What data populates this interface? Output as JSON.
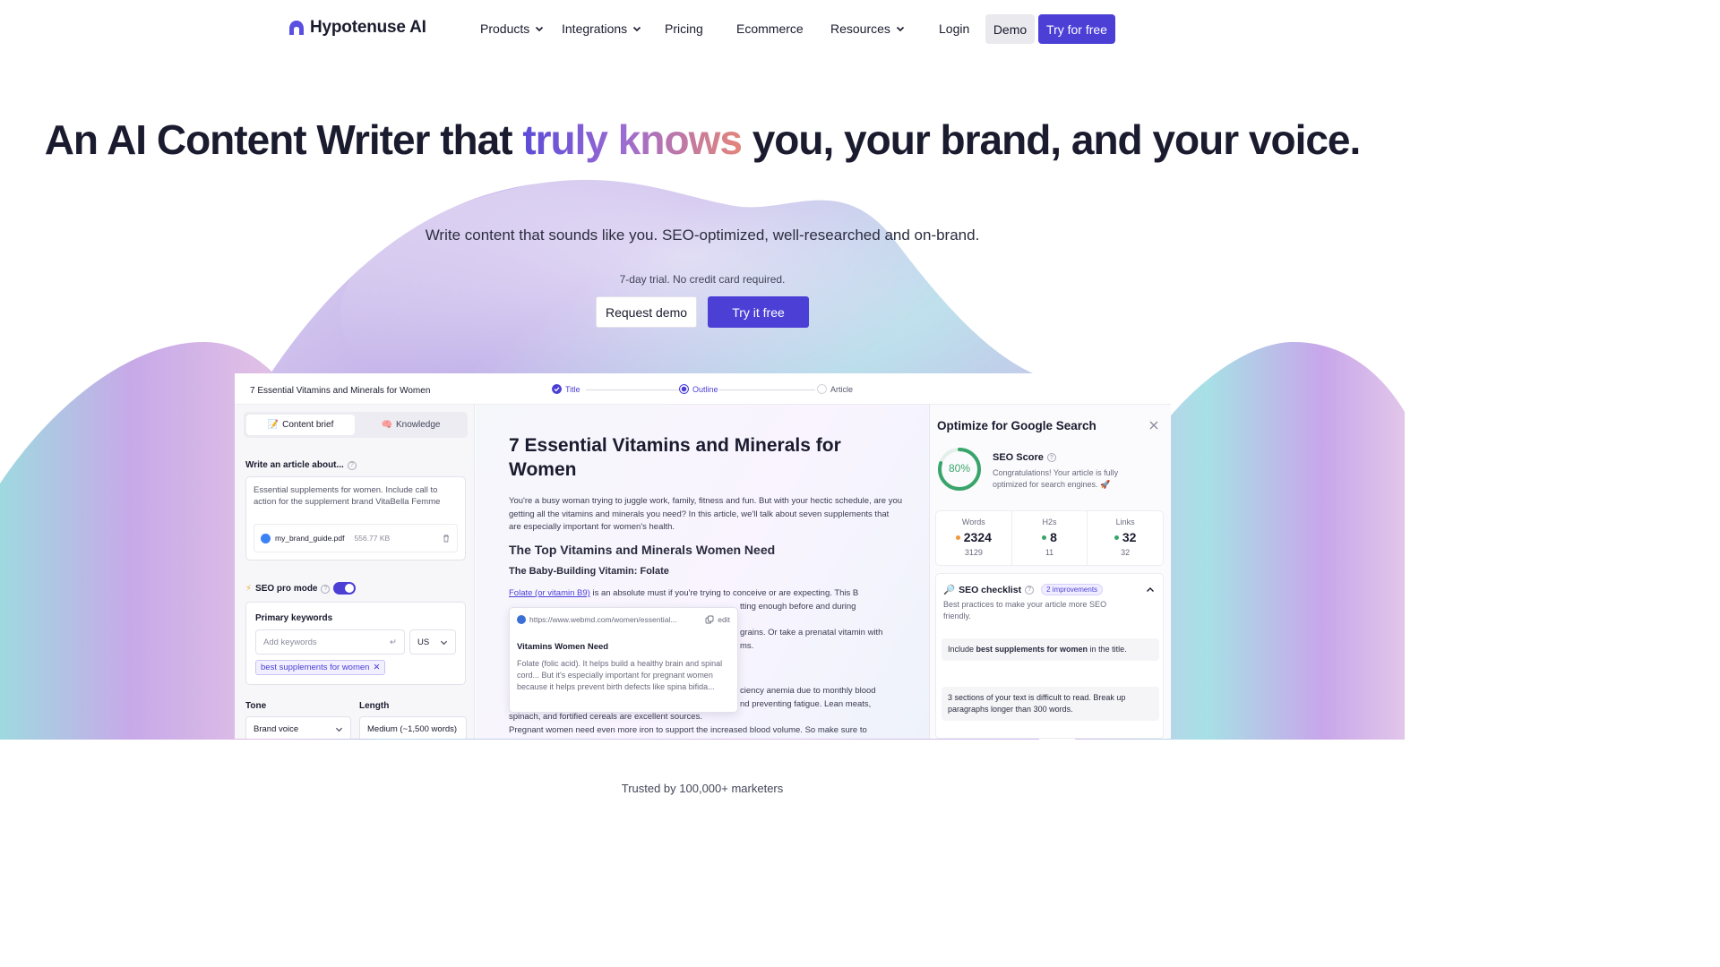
{
  "nav": {
    "logo": "Hypotenuse AI",
    "items": [
      "Products",
      "Integrations",
      "Pricing",
      "Ecommerce",
      "Resources",
      "Login"
    ],
    "demo": "Demo",
    "try": "Try for free"
  },
  "hero": {
    "title_a": "An AI Content Writer that ",
    "title_grad": "truly knows",
    "title_b": " you, your brand, and your voice.",
    "subtitle": "Write content that sounds like you. SEO-optimized, well-researched and on-brand.",
    "trial": "7-day trial. No credit card required.",
    "request_demo": "Request demo",
    "try_free": "Try it free"
  },
  "app": {
    "doc_title": "7 Essential Vitamins and Minerals for Women",
    "steps": [
      "Title",
      "Outline",
      "Article"
    ],
    "left": {
      "tab_brief": "Content brief",
      "tab_knowledge": "Knowledge",
      "write_label": "Write an article about...",
      "prompt": "Essential supplements for women. Include call to action for the supplement brand VitaBella Femme",
      "file_name": "my_brand_guide.pdf",
      "file_size": "556.77 KB",
      "seo_pro": "SEO pro mode",
      "primary_kw": "Primary keywords",
      "kw_placeholder": "Add keywords",
      "country": "US",
      "chip": "best supplements for women",
      "tone_label": "Tone",
      "tone_value": "Brand voice",
      "length_label": "Length",
      "length_value": "Medium (~1,500 words)"
    },
    "article": {
      "title": "7 Essential Vitamins and Minerals for Women",
      "intro": "You're a busy woman trying to juggle work, family, fitness and fun. But with your hectic schedule, are you getting all the vitamins and minerals you need? In this article, we'll talk about seven supplements that are especially important for women's health.",
      "h2": "The Top Vitamins and Minerals Women Need",
      "h3": "The Baby-Building Vitamin: Folate",
      "link": "Folate (or vitamin B9)",
      "p1_rest": " is an absolute must if you're trying to conceive or are expecting. This B",
      "p1_l2": "tting enough before and during",
      "p2_l1": "grains. Or take a prenatal vitamin with",
      "p2_l2": "ms.",
      "p3_l1": "ciency anemia due to monthly blood",
      "p3_l2": "nd preventing fatigue. Lean meats,",
      "p3_l3": "spinach, and fortified cereals are excellent sources.",
      "p3_l4": "Pregnant women need even more iron to support the increased blood volume. So make sure to",
      "popup_url": "https://www.webmd.com/women/essential...",
      "popup_edit": "edit",
      "popup_head": "Vitamins Women Need",
      "popup_text": "Folate (folic acid). It helps build a healthy brain and spinal cord... But it's especially important for pregnant women because it helps prevent birth defects like spina bifida..."
    },
    "seo": {
      "title": "Optimize for Google Search",
      "score_pct": "80%",
      "score_value": 0.8,
      "score_label": "SEO Score",
      "score_msg": "Congratulations! Your article is fully optimized for search engines. 🚀",
      "stats": [
        {
          "label": "Words",
          "value": "2324",
          "target": "3129",
          "color": "#f0963b"
        },
        {
          "label": "H2s",
          "value": "8",
          "target": "11",
          "color": "#3aa56a"
        },
        {
          "label": "Links",
          "value": "32",
          "target": "32",
          "color": "#3aa56a"
        }
      ],
      "checklist_title": "SEO checklist",
      "improvements": "2 improvements",
      "checklist_desc": "Best practices to make your article more SEO friendly.",
      "item1_a": "Include ",
      "item1_b": "best supplements for women",
      "item1_c": " in the title.",
      "item2": "3 sections of your text is difficult to read. Break up paragraphs longer than 300 words."
    }
  },
  "trusted": "Trusted by 100,000+ marketers",
  "colors": {
    "accent": "#4b3fd6",
    "success": "#3aa56a",
    "warning": "#f0963b"
  }
}
